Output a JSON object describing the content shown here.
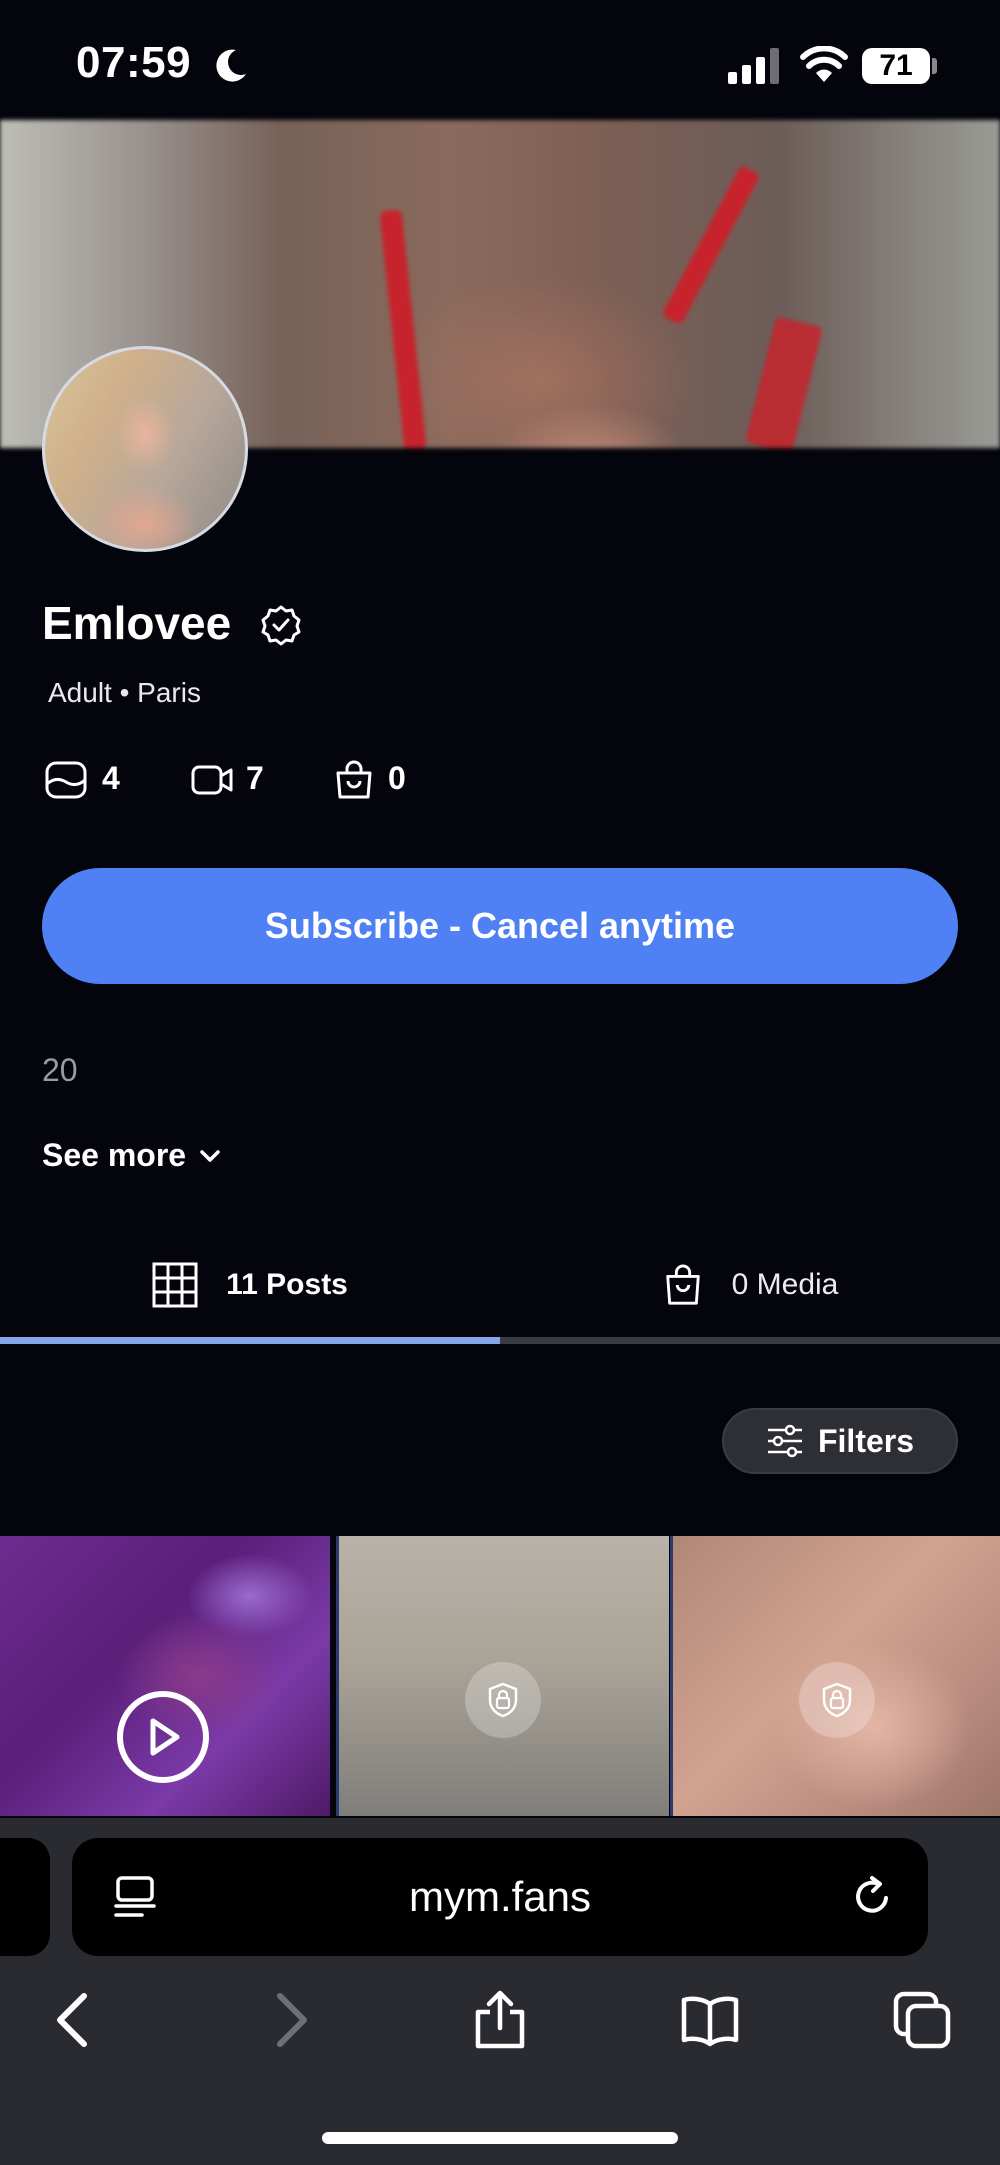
{
  "status_bar": {
    "time": "07:59",
    "battery": "71"
  },
  "profile": {
    "name": "Emlovee",
    "meta": "Adult • Paris",
    "stats": {
      "photos": "4",
      "videos": "7",
      "shop": "0"
    },
    "subscribe_label": "Subscribe - Cancel anytime",
    "bio_preview": "20",
    "see_more_label": "See more"
  },
  "tabs": [
    {
      "label": "11 Posts",
      "icon": "grid-icon",
      "active": true
    },
    {
      "label": "0 Media",
      "icon": "shopping-bag-icon",
      "active": false
    }
  ],
  "filters_label": "Filters",
  "posts": [
    {
      "type": "video",
      "locked": false
    },
    {
      "type": "image",
      "locked": true
    },
    {
      "type": "image",
      "locked": true
    }
  ],
  "browser": {
    "url": "mym.fans"
  },
  "colors": {
    "accent": "#4f81f5",
    "background": "#04050c",
    "tab_indicator": "#86a6ea"
  }
}
